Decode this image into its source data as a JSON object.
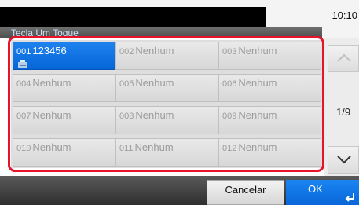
{
  "status_bar": {
    "clock": "10:10"
  },
  "screen": {
    "title": "Tecla Um Toque"
  },
  "keys": [
    {
      "num": "001",
      "label": "123456",
      "selected": true,
      "icon": "fax-icon"
    },
    {
      "num": "002",
      "label": "Nenhum"
    },
    {
      "num": "003",
      "label": "Nenhum"
    },
    {
      "num": "004",
      "label": "Nenhum"
    },
    {
      "num": "005",
      "label": "Nenhum"
    },
    {
      "num": "006",
      "label": "Nenhum"
    },
    {
      "num": "007",
      "label": "Nenhum"
    },
    {
      "num": "008",
      "label": "Nenhum"
    },
    {
      "num": "009",
      "label": "Nenhum"
    },
    {
      "num": "010",
      "label": "Nenhum"
    },
    {
      "num": "011",
      "label": "Nenhum"
    },
    {
      "num": "012",
      "label": "Nenhum"
    }
  ],
  "pagination": {
    "indicator": "1/9",
    "up_icon": "chevron-up-icon",
    "down_icon": "chevron-down-icon"
  },
  "footer": {
    "cancel_label": "Cancelar",
    "ok_label": "OK",
    "ok_icon": "enter-icon"
  },
  "colors": {
    "highlight": "#e8132a",
    "accent": "#0a72e4"
  }
}
